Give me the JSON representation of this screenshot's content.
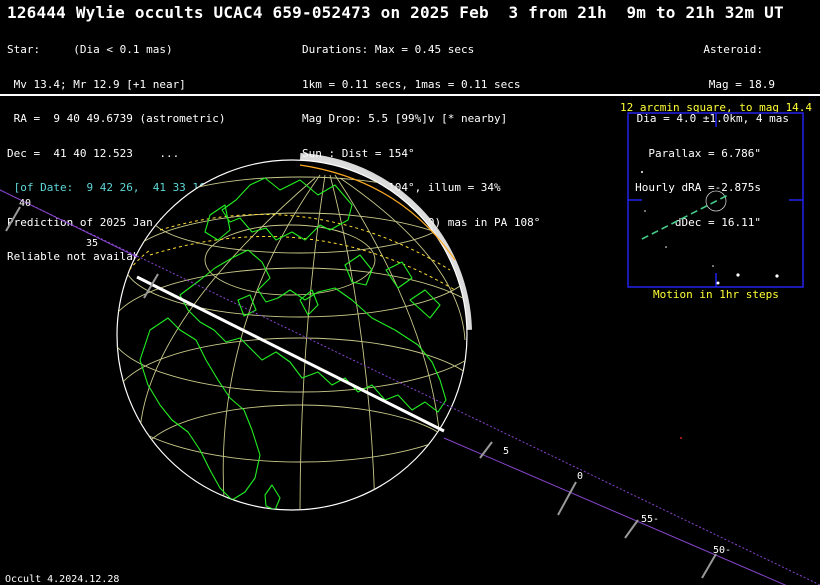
{
  "title": "126444 Wylie occults UCAC4 659-052473 on 2025 Feb  3 from 21h  9m to 21h 32m UT",
  "star": {
    "l1": "Star:     (Dia < 0.1 mas)",
    "l2": " Mv 13.4; Mr 12.9 [+1 near]",
    "l3": " RA =  9 40 49.6739 (astrometric)",
    "l4": "Dec =  41 40 12.523    ...",
    "l5": " [of Date:  9 42 26,  41 33 16]",
    "l6": "Prediction of 2025 Jan 25.9",
    "l7": "Reliable not available"
  },
  "event": {
    "l1": "Durations: Max = 0.45 secs",
    "l2": "1km = 0.11 secs, 1mas = 0.11 secs",
    "l3": "Mag Drop: 5.5 [99%]v [* nearby]",
    "l4": "Sun : Dist = 154°",
    "l5": "Moon: Dist = 104°, illum = 34%",
    "l6": "1σ Err: ±(11.0 x 1.0) mas in PA 108°"
  },
  "asteroid": {
    "l1": "Asteroid:",
    "l2": "Mag = 18.9",
    "l3": "Dia = 4.0 ±1.0km, 4 mas",
    "l4": "Parallax = 6.786\"",
    "l5": "Hourly dRA =-2.875s",
    "l6": "dDec = 16.11\""
  },
  "finder": {
    "top_label": "12 arcmin square, to mag 14.4",
    "bottom_label": "Motion in 1hr steps"
  },
  "track_labels": [
    "40",
    "35",
    "5",
    "0",
    "55-",
    "50-"
  ],
  "footer": "Occult 4.2024.12.28",
  "colors": {
    "coast": "#22ee22",
    "grid": "#c8c88a",
    "path": "#ffffff",
    "track": "#8844cc",
    "finder": "#2222ee",
    "label": "#ffff33"
  }
}
